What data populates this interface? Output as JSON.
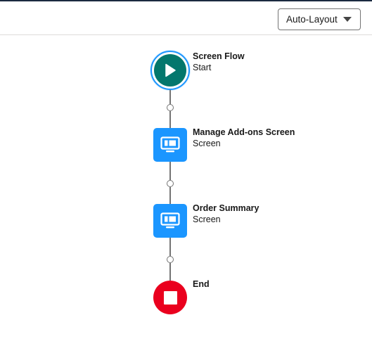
{
  "toolbar": {
    "layout_select": {
      "value": "Auto-Layout",
      "icon": "chevron-down-icon"
    }
  },
  "flow": {
    "nodes": [
      {
        "title": "Screen Flow",
        "subtitle": "Start",
        "kind": "start",
        "icon": "play-icon",
        "color": "#04776d"
      },
      {
        "title": "Manage Add-ons Screen",
        "subtitle": "Screen",
        "kind": "screen",
        "icon": "screen-icon",
        "color": "#1b96ff"
      },
      {
        "title": "Order Summary",
        "subtitle": "Screen",
        "kind": "screen",
        "icon": "screen-icon",
        "color": "#1b96ff"
      },
      {
        "title": "End",
        "subtitle": "",
        "kind": "end",
        "icon": "stop-icon",
        "color": "#ea001e"
      }
    ]
  },
  "colors": {
    "selection_ring": "#1b96ff",
    "connector": "#747474",
    "header_border": "#1b2a40"
  }
}
